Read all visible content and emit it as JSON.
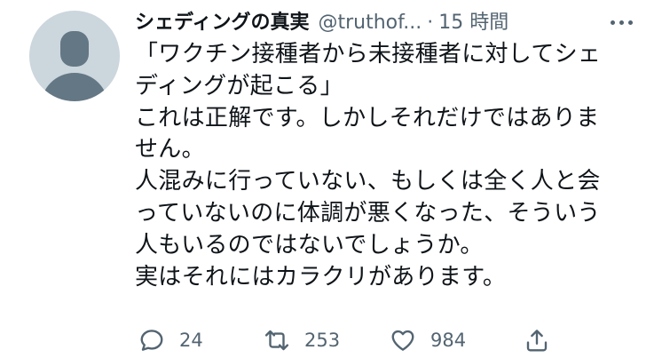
{
  "tweet": {
    "display_name": "シェディングの真実",
    "handle": "@truthof...",
    "separator": "·",
    "timestamp": "15 時間",
    "lines": [
      "「ワクチン接種者から未接種者に対してシェ",
      "ディングが起こる」",
      "これは正解です。しかしそれだけではありま",
      "せん。",
      "人混みに行っていない、もしくは全く人と会",
      "っていないのに体調が悪くなった、そういう",
      "人もいるのではないでしょうか。",
      "実はそれにはカラクリがあります。"
    ],
    "actions": {
      "reply_count": "24",
      "retweet_count": "253",
      "like_count": "984"
    }
  },
  "icons": {
    "avatar": "default-avatar-icon",
    "more": "more-options-icon",
    "reply": "reply-icon",
    "retweet": "retweet-icon",
    "like": "heart-icon",
    "share": "share-icon"
  },
  "colors": {
    "text": "#0f1419",
    "secondary": "#536471",
    "avatar_bg": "#ccd6dd",
    "avatar_fg": "#647785"
  }
}
